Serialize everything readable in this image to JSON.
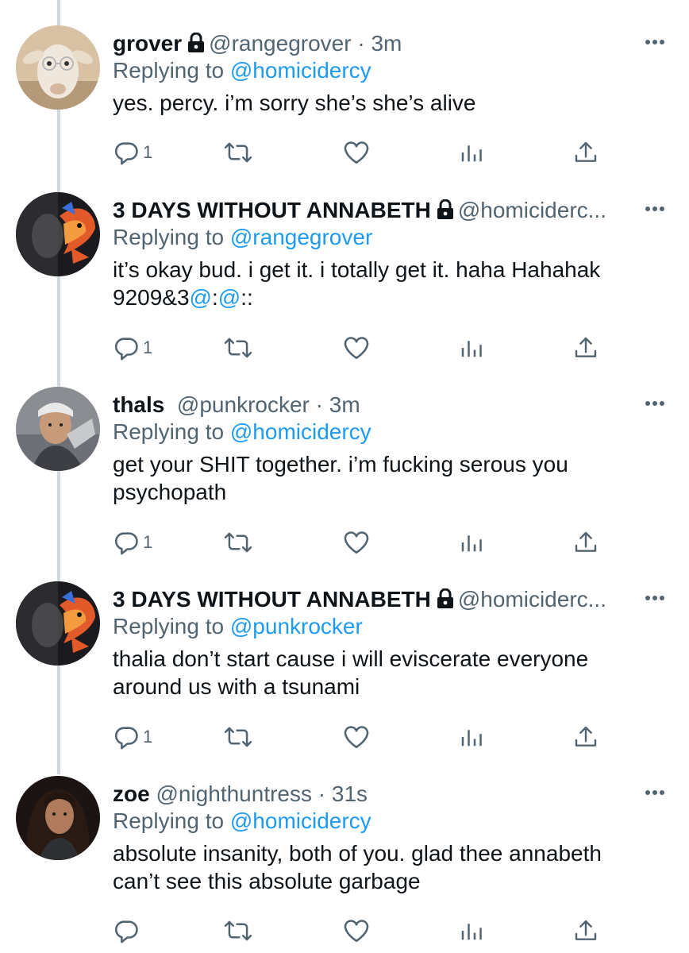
{
  "tweets": [
    {
      "name": "grover",
      "locked": true,
      "handle": "@rangegrover",
      "dot": " · ",
      "time": "3m",
      "replying_prefix": "Replying to ",
      "replying_to": "@homicidercy",
      "text_parts": [
        "yes. percy. i’m sorry she’s she’s alive"
      ],
      "reply_count": "1",
      "avatar_icon": "goat-with-glasses-avatar"
    },
    {
      "name": "3 DAYS WITHOUT ANNABETH",
      "locked": true,
      "handle": "@homiciderc...",
      "dot": "",
      "time": "",
      "replying_prefix": "Replying to ",
      "replying_to": "@rangegrover",
      "text_line1": "it’s okay bud. i get it. i totally get it. haha Hahahak",
      "text_line2_a": "9209&3",
      "text_line2_m1": "@",
      "text_line2_b": ":",
      "text_line2_m2": "@",
      "text_line2_c": "::",
      "reply_count": "1",
      "avatar_icon": "half-face-fish-avatar"
    },
    {
      "name": "thals",
      "locked": false,
      "handle": "@punkrocker",
      "dot": " · ",
      "time": "3m",
      "replying_prefix": "Replying to ",
      "replying_to": "@homicidercy",
      "text_line1": "get your SHIT together. i’m fucking serous you",
      "text_line2": "psychopath",
      "reply_count": "1",
      "avatar_icon": "person-with-headband-avatar"
    },
    {
      "name": "3 DAYS WITHOUT ANNABETH",
      "locked": true,
      "handle": "@homiciderc...",
      "dot": "",
      "time": "",
      "replying_prefix": "Replying to ",
      "replying_to": "@punkrocker",
      "text_line1": "thalia don’t start cause i will eviscerate everyone",
      "text_line2": "around us with a tsunami",
      "reply_count": "1",
      "avatar_icon": "half-face-fish-avatar"
    },
    {
      "name": "zoe",
      "locked": false,
      "handle": "@nighthuntress",
      "dot": " · ",
      "time": "31s",
      "replying_prefix": "Replying to ",
      "replying_to": "@homicidercy",
      "text_line1": "absolute insanity, both of you. glad thee annabeth",
      "text_line2": "can’t see this absolute garbage",
      "reply_count": "",
      "avatar_icon": "curly-hair-woman-avatar"
    }
  ],
  "colors": {
    "accent": "#1d9bf0",
    "secondary_text": "#536471",
    "primary_text": "#0f1419",
    "thread_line": "#cfd9de"
  },
  "icons": [
    "lock-icon",
    "more-icon",
    "reply-icon",
    "retweet-icon",
    "like-icon",
    "stats-icon",
    "share-icon"
  ]
}
